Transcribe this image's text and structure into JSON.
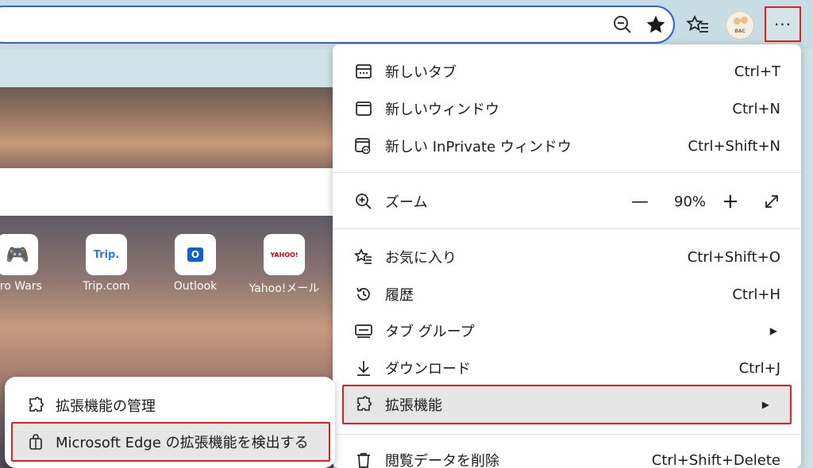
{
  "toolbar": {
    "zoom_icon": "zoom-out-icon",
    "favorite_icon": "star-icon",
    "favorites_icon": "favorites-bar-icon",
    "profile_text": "BAC",
    "more_label": "···"
  },
  "new_tab": {
    "tiles": [
      {
        "label": "ero Wars",
        "icon": "🎮"
      },
      {
        "label": "Trip.com",
        "icon": "Trip."
      },
      {
        "label": "Outlook",
        "icon": "O"
      },
      {
        "label": "Yahoo!メール",
        "icon": "YAHOO!"
      }
    ]
  },
  "menu": {
    "new_tab": {
      "label": "新しいタブ",
      "shortcut": "Ctrl+T"
    },
    "new_window": {
      "label": "新しいウィンドウ",
      "shortcut": "Ctrl+N"
    },
    "new_inprivate": {
      "label": "新しい InPrivate ウィンドウ",
      "shortcut": "Ctrl+Shift+N"
    },
    "zoom": {
      "label": "ズーム",
      "minus": "—",
      "value": "90%",
      "plus": "+"
    },
    "favorites": {
      "label": "お気に入り",
      "shortcut": "Ctrl+Shift+O"
    },
    "history": {
      "label": "履歴",
      "shortcut": "Ctrl+H"
    },
    "tab_groups": {
      "label": "タブ グループ"
    },
    "downloads": {
      "label": "ダウンロード",
      "shortcut": "Ctrl+J"
    },
    "extensions": {
      "label": "拡張機能"
    },
    "clear_data": {
      "label": "閲覧データを削除",
      "shortcut": "Ctrl+Shift+Delete"
    }
  },
  "submenu": {
    "manage": {
      "label": "拡張機能の管理"
    },
    "discover": {
      "label": "Microsoft Edge の拡張機能を検出する"
    }
  },
  "colors": {
    "accent": "#2b63d8",
    "highlight_border": "#e02020"
  }
}
